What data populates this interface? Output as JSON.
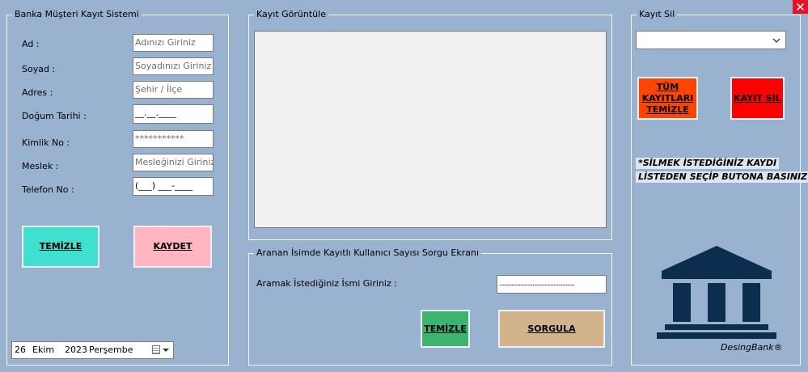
{
  "window": {
    "close_glyph": "✕"
  },
  "register": {
    "title": "Banka Müşteri Kayıt Sistemi",
    "fields": [
      {
        "label": "Ad :",
        "value": "Adınızı Giriniz"
      },
      {
        "label": "Soyad :",
        "value": "Soyadınızı Giriniz"
      },
      {
        "label": "Adres :",
        "value": "Şehir / İlçe"
      },
      {
        "label": "Doğum Tarihi :",
        "value": "__.__.____"
      },
      {
        "label": "Kimlik No :",
        "value": "***********"
      },
      {
        "label": "Meslek :",
        "value": "Mesleğinizi Giriniz"
      },
      {
        "label": "Telefon No :",
        "value": "(___) ___-____"
      }
    ],
    "clear_label": "TEMİZLE",
    "save_label": "KAYDET",
    "clear_color": "#40e0d0",
    "save_color": "#ffb6c1",
    "date": {
      "day": "26",
      "month": "Ekim",
      "year": "2023",
      "weekday": "Perşembe"
    }
  },
  "view": {
    "title": "Kayıt Görüntüle"
  },
  "query": {
    "title": "Aranan İsimde Kayıtlı Kullanıcı Sayısı Sorgu Ekranı",
    "prompt": "Aramak İstediğiniz İsmi Giriniz :",
    "input_value": "..................................................",
    "clear_label": "TEMİZLE",
    "query_label": "SORGULA",
    "clear_color": "#3cb371",
    "query_color": "#d2b48c"
  },
  "delete": {
    "title": "Kayıt Sil",
    "select_value": "",
    "clear_all_label": "TÜM KAYITLARI TEMİZLE",
    "delete_label": "KAYIT SİL",
    "clear_all_color": "#ff4500",
    "delete_color": "#ff0000",
    "hint_line1": "*SİLMEK İSTEDİĞİNİZ KAYDI",
    "hint_line2": "LİSTEDEN SEÇİP BUTONA BASINIZ!",
    "brand": "DesingBank®",
    "logo_color": "#0d2d4f"
  }
}
